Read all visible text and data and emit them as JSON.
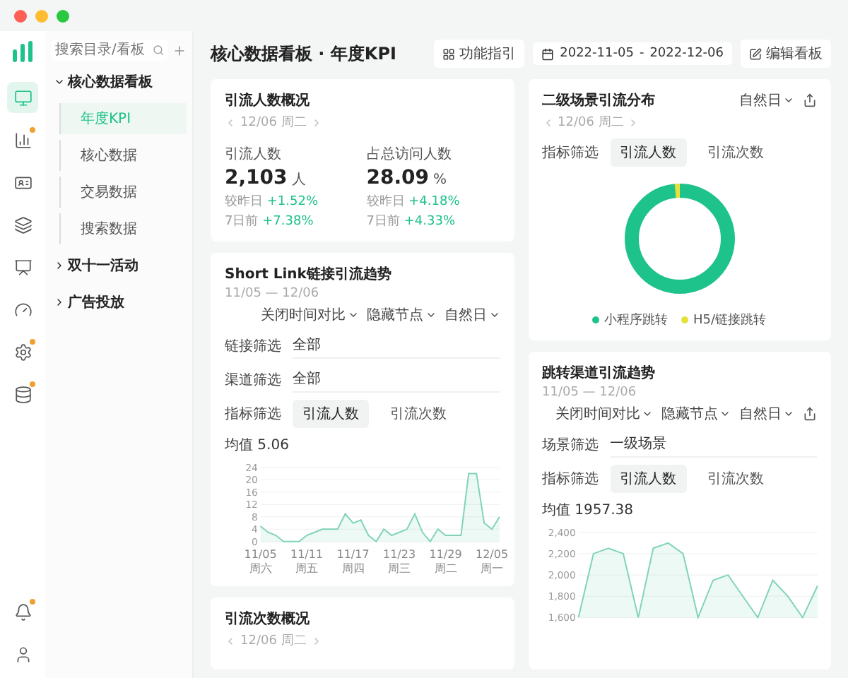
{
  "rail": {
    "items": [
      {
        "kind": "monitor",
        "selected": true,
        "dot": false
      },
      {
        "kind": "bars",
        "selected": false,
        "dot": true
      },
      {
        "kind": "card",
        "selected": false,
        "dot": false
      },
      {
        "kind": "layers",
        "selected": false,
        "dot": false
      },
      {
        "kind": "screen",
        "selected": false,
        "dot": false
      },
      {
        "kind": "gauge",
        "selected": false,
        "dot": false
      },
      {
        "kind": "gear",
        "selected": false,
        "dot": true
      },
      {
        "kind": "database",
        "selected": false,
        "dot": true
      }
    ],
    "bottom": [
      {
        "kind": "bell",
        "selected": false,
        "dot": true
      },
      {
        "kind": "avatar",
        "selected": false,
        "dot": false
      }
    ]
  },
  "tree": {
    "search": {
      "placeholder": "搜索目录/看板"
    },
    "items": [
      {
        "label": "核心数据看板",
        "expanded": true,
        "children": [
          {
            "label": "年度KPI",
            "selected": true
          },
          {
            "label": "核心数据",
            "selected": false
          },
          {
            "label": "交易数据",
            "selected": false
          },
          {
            "label": "搜索数据",
            "selected": false
          }
        ]
      },
      {
        "label": "双十一活动",
        "expanded": false
      },
      {
        "label": "广告投放",
        "expanded": false
      }
    ]
  },
  "header": {
    "title": "核心数据看板 · 年度KPI",
    "guide_button": "功能指引",
    "date_start": "2022-11-05",
    "date_sep": "-",
    "date_end": "2022-12-06",
    "edit_button": "编辑看板"
  },
  "overview": {
    "title": "引流人数概况",
    "date": "12/06 周二",
    "metrics": [
      {
        "label": "引流人数",
        "value": "2,103",
        "unit": "人",
        "compare": [
          {
            "label": "较昨日",
            "delta": "+1.52%"
          },
          {
            "label": "7日前",
            "delta": "+7.38%"
          }
        ]
      },
      {
        "label": "占总访问人数",
        "value": "28.09",
        "unit": "%",
        "compare": [
          {
            "label": "较昨日",
            "delta": "+4.18%"
          },
          {
            "label": "7日前",
            "delta": "+4.33%"
          }
        ]
      }
    ]
  },
  "link_trend": {
    "title": "Short Link链接引流趋势",
    "range": "11/05 — 12/06",
    "controls": [
      "关闭时间对比",
      "隐藏节点",
      "自然日"
    ],
    "filters": [
      {
        "label": "链接筛选",
        "kind": "select",
        "value": "全部"
      },
      {
        "label": "渠道筛选",
        "kind": "select",
        "value": "全部"
      },
      {
        "label": "指标筛选",
        "kind": "pills",
        "options": [
          {
            "label": "引流人数",
            "selected": true
          },
          {
            "label": "引流次数",
            "selected": false
          }
        ]
      }
    ],
    "mean": "均值 5.06",
    "chart_data": {
      "type": "area",
      "grid": true,
      "ylim": [
        0,
        24
      ],
      "yticks": [
        0,
        4,
        8,
        12,
        16,
        20,
        24
      ],
      "categories": [
        "11/05 周六",
        null,
        null,
        null,
        null,
        null,
        "11/11 周五",
        null,
        null,
        null,
        null,
        null,
        "11/17 周四",
        null,
        null,
        null,
        null,
        null,
        "11/23 周三",
        null,
        null,
        null,
        null,
        null,
        "11/29 周二",
        null,
        null,
        null,
        null,
        null,
        "12/05 周一",
        null
      ],
      "series": [
        {
          "color": "#7fd4b4",
          "values": [
            5,
            3,
            2,
            0,
            0,
            0,
            2,
            3,
            4,
            4,
            4,
            9,
            6,
            7,
            2,
            0,
            4,
            2,
            3,
            4,
            9,
            3,
            0,
            4,
            2,
            2,
            2,
            22,
            22,
            6,
            4,
            8
          ]
        }
      ]
    }
  },
  "count_overview": {
    "title": "引流次数概况",
    "date": "12/06 周二"
  },
  "scene_dist": {
    "title": "二级场景引流分布",
    "date": "12/06 周二",
    "period": "自然日",
    "filters": [
      {
        "label": "指标筛选",
        "kind": "pills",
        "options": [
          {
            "label": "引流人数",
            "selected": true
          },
          {
            "label": "引流次数",
            "selected": false
          }
        ]
      }
    ],
    "legend": [
      {
        "label": "小程序跳转",
        "color": "#1ec28b"
      },
      {
        "label": "H5/链接跳转",
        "color": "#e6e03a"
      }
    ]
  },
  "channel_trend": {
    "title": "跳转渠道引流趋势",
    "range": "11/05 — 12/06",
    "controls": [
      "关闭时间对比",
      "隐藏节点",
      "自然日"
    ],
    "filters": [
      {
        "label": "场景筛选",
        "kind": "select",
        "value": "一级场景"
      },
      {
        "label": "指标筛选",
        "kind": "pills",
        "options": [
          {
            "label": "引流人数",
            "selected": true
          },
          {
            "label": "引流次数",
            "selected": false
          }
        ]
      }
    ],
    "mean": "均值 1957.38",
    "chart_data": {
      "type": "area",
      "grid": true,
      "ylim": [
        1600,
        2400
      ],
      "yticks": [
        {
          "value": 1600,
          "label": "1,600"
        },
        {
          "value": 1800,
          "label": "1,800"
        },
        {
          "value": 2000,
          "label": "2,000"
        },
        {
          "value": 2200,
          "label": "2,200"
        },
        {
          "value": 2400,
          "label": "2,400"
        }
      ],
      "series": [
        {
          "color": "#7fd4b4",
          "values": [
            1600,
            2200,
            2250,
            2200,
            1600,
            2250,
            2300,
            2200,
            1600,
            1950,
            2000,
            1800,
            1600,
            1950,
            1800,
            1600,
            1900
          ]
        }
      ]
    }
  }
}
